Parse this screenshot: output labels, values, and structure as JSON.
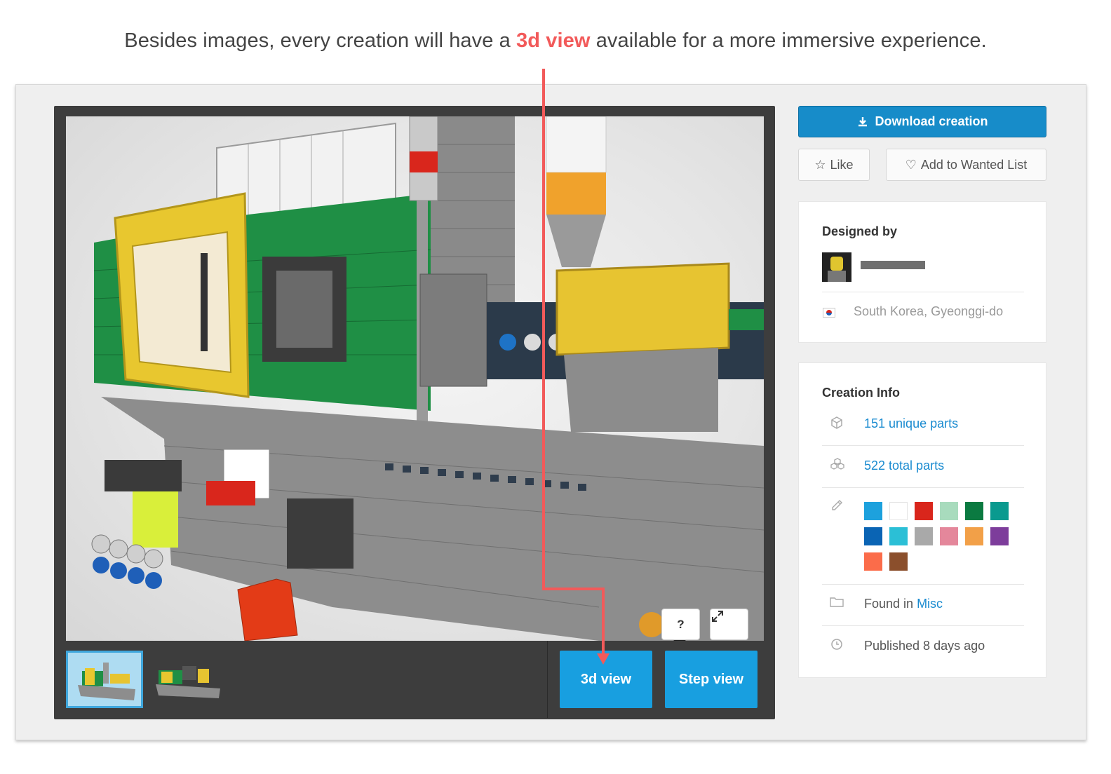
{
  "caption": {
    "before": "Besides images, every creation will have a ",
    "highlight": "3d view",
    "after": " available for a more immersive experience."
  },
  "viewer": {
    "help_button": "?",
    "expand_icon": "expand-icon",
    "buttons": {
      "three_d": "3d view",
      "step": "Step view"
    },
    "thumbnails": [
      "thumbnail-1",
      "thumbnail-2"
    ]
  },
  "actions": {
    "download": "Download creation",
    "like": "Like",
    "wanted": "Add to Wanted List"
  },
  "designer": {
    "heading": "Designed by",
    "name_redacted": true,
    "location": "South Korea, Gyeonggi-do",
    "flag_icon": "south-korea-flag-icon"
  },
  "creation_info": {
    "heading": "Creation Info",
    "unique_parts": "151 unique parts",
    "total_parts": "522 total parts",
    "found_prefix": "Found in ",
    "category": "Misc",
    "published": "Published 8 days ago",
    "colors": [
      "#1da1dd",
      "#ffffff",
      "#d9261c",
      "#a8dbbd",
      "#0b7a41",
      "#0a9a8f",
      "#0a64b4",
      "#2bbfd6",
      "#a9a9a9",
      "#e4879b",
      "#f2a048",
      "#7d3d9b",
      "#fb6c4a",
      "#8b4f2c"
    ]
  },
  "colors": {
    "accent": "#189fe0",
    "download": "#178cc9",
    "annotation": "#f25a5a",
    "link": "#1a8bd0"
  }
}
